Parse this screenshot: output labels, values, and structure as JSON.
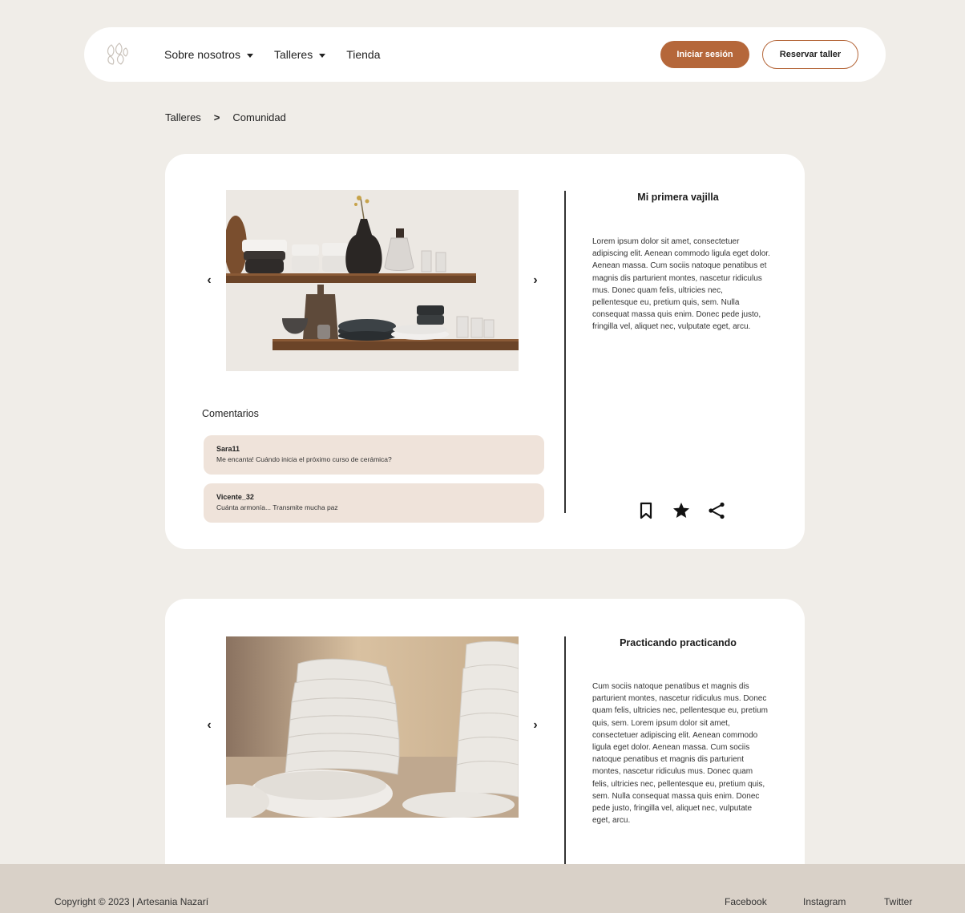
{
  "nav": {
    "links": [
      {
        "label": "Sobre nosotros",
        "dropdown": true
      },
      {
        "label": "Talleres",
        "dropdown": true
      },
      {
        "label": "Tienda",
        "dropdown": false
      }
    ],
    "login_label": "Iniciar sesión",
    "book_label": "Reservar taller"
  },
  "breadcrumb": {
    "items": [
      "Talleres",
      "Comunidad"
    ]
  },
  "posts": [
    {
      "title": "Mi primera vajilla",
      "body": "Lorem ipsum dolor sit amet, consectetuer adipiscing elit. Aenean commodo ligula eget dolor. Aenean massa. Cum sociis natoque penatibus et magnis dis parturient montes, nascetur ridiculus mus. Donec quam felis, ultricies nec, pellentesque eu, pretium quis, sem. Nulla consequat massa quis enim. Donec pede justo, fringilla vel, aliquet nec, vulputate eget, arcu.",
      "comments_title": "Comentarios",
      "comments": [
        {
          "user": "Sara11",
          "text": "Me encanta! Cuándo inicia el próximo curso de cerámica?"
        },
        {
          "user": "Vicente_32",
          "text": "Cuánta armonía... Transmite mucha paz"
        }
      ],
      "prev_arrow": "‹",
      "next_arrow": "›"
    },
    {
      "title": "Practicando practicando",
      "body": "Cum sociis natoque penatibus et magnis dis parturient montes, nascetur ridiculus mus. Donec quam felis, ultricies nec, pellentesque eu, pretium quis, sem. Lorem ipsum dolor sit amet, consectetuer adipiscing elit. Aenean commodo ligula eget dolor. Aenean massa. Cum sociis natoque penatibus et magnis dis parturient montes, nascetur ridiculus mus. Donec quam felis, ultricies nec, pellentesque eu, pretium quis, sem. Nulla consequat massa quis enim. Donec pede justo, fringilla vel, aliquet nec, vulputate eget, arcu.",
      "prev_arrow": "‹",
      "next_arrow": "›"
    }
  ],
  "icons": [
    "bookmark-icon",
    "star-icon",
    "share-icon"
  ],
  "footer": {
    "copyright": "Copyright © 2023 | Artesania Nazarí",
    "social": [
      "Facebook",
      "Instagram",
      "Twitter"
    ]
  },
  "colors": {
    "background": "#f0ede8",
    "accent": "#b5673a",
    "comment_bg": "#efe3da",
    "footer_bg": "#d9d1c8"
  }
}
